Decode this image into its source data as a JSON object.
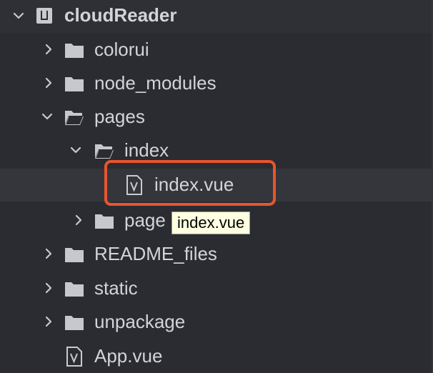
{
  "root": {
    "label": "cloudReader",
    "expanded": true
  },
  "tree": [
    {
      "label": "colorui",
      "type": "folder",
      "expanded": false
    },
    {
      "label": "node_modules",
      "type": "folder",
      "expanded": false
    },
    {
      "label": "pages",
      "type": "folder",
      "expanded": true
    },
    {
      "label": "index",
      "type": "folder",
      "expanded": true
    },
    {
      "label": "index.vue",
      "type": "vue-file",
      "selected": true
    },
    {
      "label": "page",
      "type": "folder",
      "expanded": false
    },
    {
      "label": "README_files",
      "type": "folder",
      "expanded": false
    },
    {
      "label": "static",
      "type": "folder",
      "expanded": false
    },
    {
      "label": "unpackage",
      "type": "folder",
      "expanded": false
    },
    {
      "label": "App.vue",
      "type": "vue-file"
    }
  ],
  "tooltip": {
    "text": "index.vue"
  },
  "colors": {
    "background": "#2b2c31",
    "selected_row": "#35363c",
    "highlight": "#e8552d",
    "tooltip_bg": "#ffffe1"
  }
}
